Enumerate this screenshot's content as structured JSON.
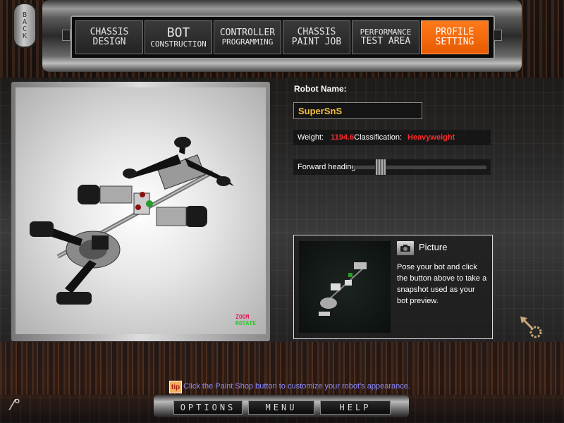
{
  "nav": {
    "back": "BACK",
    "tabs": [
      {
        "l1": "CHASSIS",
        "l2": "DESIGN"
      },
      {
        "l1": "BOT",
        "l2": "CONSTRUCTION"
      },
      {
        "l1": "CONTROLLER",
        "l2": "PROGRAMMING"
      },
      {
        "l1": "CHASSIS",
        "l2": "PAINT JOB"
      },
      {
        "l1": "PERFORMANCE",
        "l2": "TEST AREA"
      },
      {
        "l1": "PROFILE",
        "l2": "SETTING"
      }
    ],
    "active_color": "#ff6a00"
  },
  "viewer": {
    "zoom_label": "ZOOM",
    "rotate_label": "ROTATE"
  },
  "profile": {
    "name_label": "Robot Name:",
    "name_value": "SuperSnS",
    "weight_label": "Weight:",
    "weight_value": "1194.6",
    "class_label": "Classification:",
    "class_value": "Heavyweight",
    "heading_label": "Forward heading:",
    "heading_value": 0.18
  },
  "picture": {
    "title": "Picture",
    "description": "Pose your bot and click the button above to take a snapshot used as your bot preview."
  },
  "hint": {
    "icon": "tip-icon",
    "text": "Click the Paint Shop button to customize your robot's appearance."
  },
  "bottom": {
    "options": "OPTIONS",
    "menu": "MENU",
    "help": "HELP"
  },
  "colors": {
    "accent_orange": "#ff6a00",
    "warning_red": "#ff2a2a",
    "name_gold": "#f5c040",
    "hint_blue": "#8a8cff"
  }
}
